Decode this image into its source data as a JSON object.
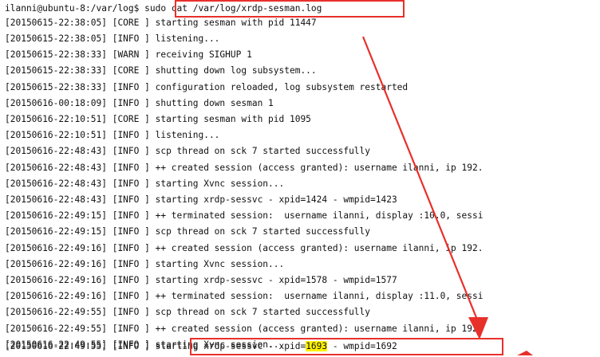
{
  "prompt": {
    "user_host_path": "ilanni@ubuntu-8:/var/log$ ",
    "command": "sudo cat /var/log/xrdp-sesman.log"
  },
  "log_lines": [
    "[20150615-22:38:05] [CORE ] starting sesman with pid 11447",
    "[20150615-22:38:05] [INFO ] listening...",
    "[20150615-22:38:33] [WARN ] receiving SIGHUP 1",
    "[20150615-22:38:33] [CORE ] shutting down log subsystem...",
    "[20150615-22:38:33] [INFO ] configuration reloaded, log subsystem restarted",
    "[20150616-00:18:09] [INFO ] shutting down sesman 1",
    "[20150616-22:10:51] [CORE ] starting sesman with pid 1095",
    "[20150616-22:10:51] [INFO ] listening...",
    "[20150616-22:48:43] [INFO ] scp thread on sck 7 started successfully",
    "[20150616-22:48:43] [INFO ] ++ created session (access granted): username ilanni, ip 192.",
    "[20150616-22:48:43] [INFO ] starting Xvnc session...",
    "[20150616-22:48:43] [INFO ] starting xrdp-sessvc - xpid=1424 - wmpid=1423",
    "[20150616-22:49:15] [INFO ] ++ terminated session:  username ilanni, display :10.0, sessi",
    "[20150616-22:49:15] [INFO ] scp thread on sck 7 started successfully",
    "[20150616-22:49:16] [INFO ] ++ created session (access granted): username ilanni, ip 192.",
    "[20150616-22:49:16] [INFO ] starting Xvnc session...",
    "[20150616-22:49:16] [INFO ] starting xrdp-sessvc - xpid=1578 - wmpid=1577",
    "[20150616-22:49:16] [INFO ] ++ terminated session:  username ilanni, display :11.0, sessi",
    "[20150616-22:49:55] [INFO ] scp thread on sck 7 started successfully",
    "[20150616-22:49:55] [INFO ] ++ created session (access granted): username ilanni, ip 192.",
    "[20150616-22:49:55] [INFO ] starting Xvnc session..."
  ],
  "last_line": {
    "prefix": "[20150616-22:49:55] [INFO ] ",
    "msg_before": "starting xrdp-sessvc - xpid=",
    "highlight": "1693",
    "msg_after": " - wmpid=1692"
  },
  "annotation_color": "#e8302b",
  "highlight_color": "#fff200"
}
